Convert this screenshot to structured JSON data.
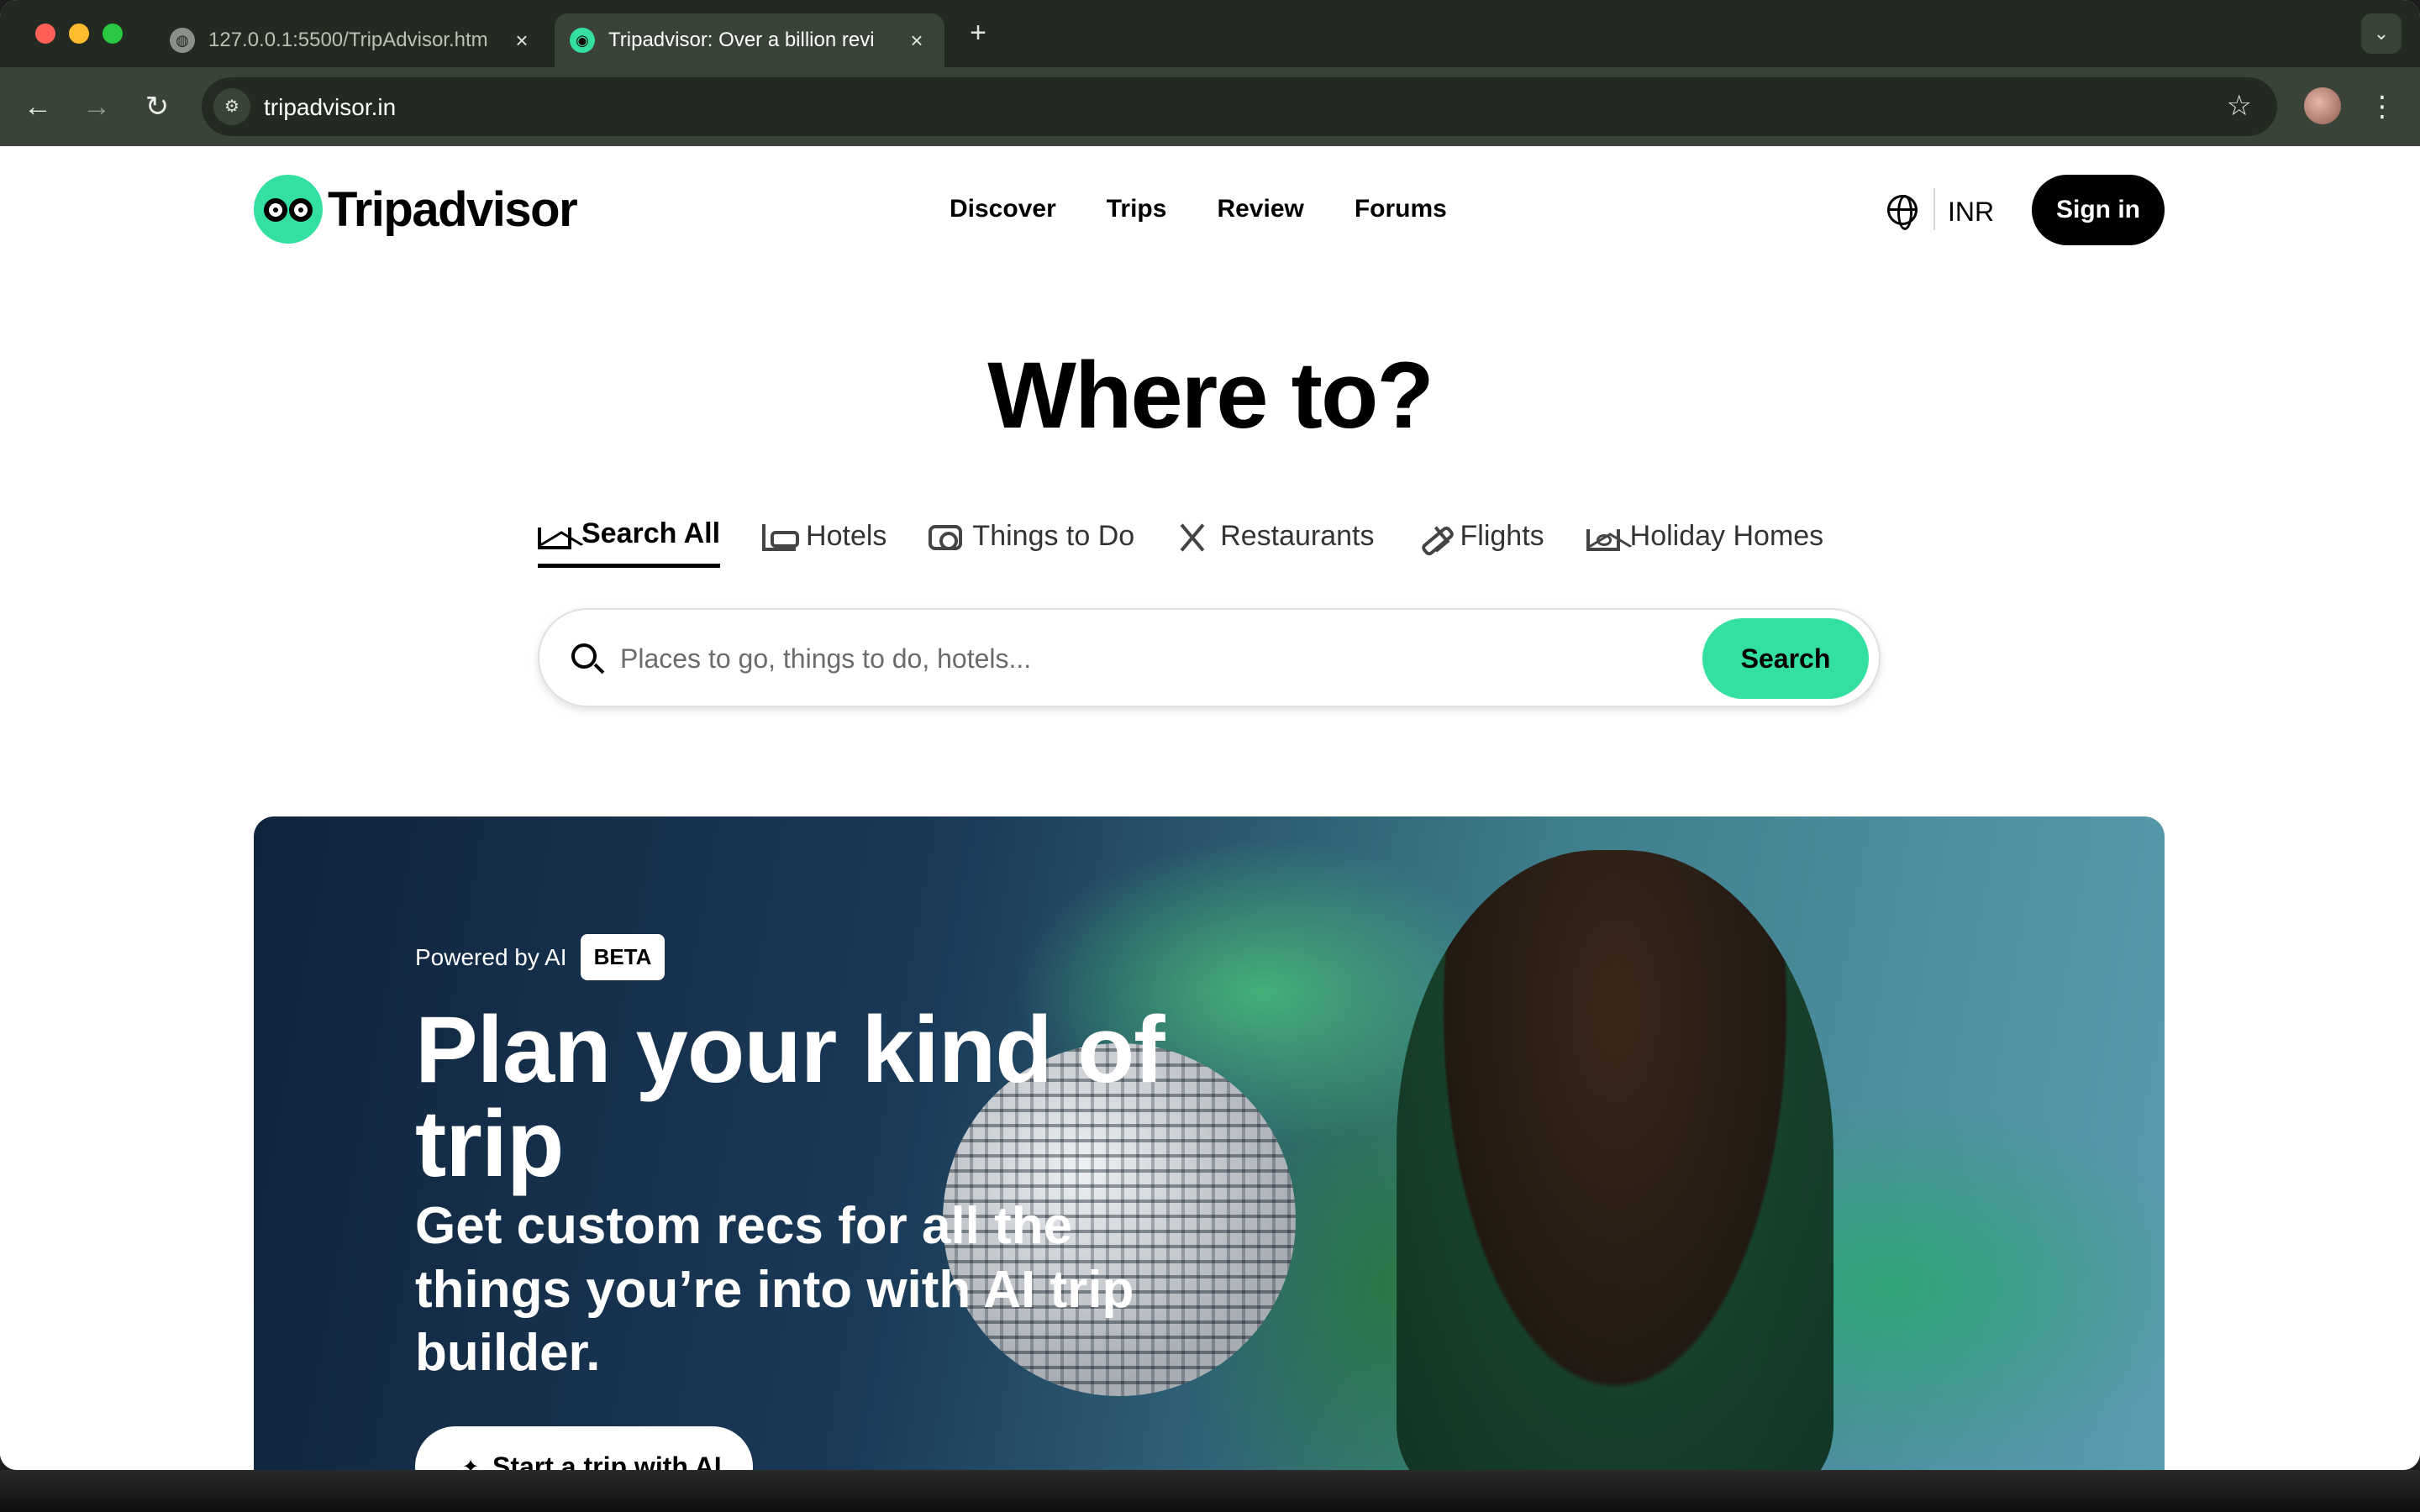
{
  "browser": {
    "tabs": [
      {
        "title": "127.0.0.1:5500/TripAdvisor.htm",
        "favicon": "globe-icon"
      },
      {
        "title": "Tripadvisor: Over a billion revi",
        "favicon": "tripadvisor-owl-icon",
        "active": true
      }
    ],
    "new_tab": "+",
    "address": "tripadvisor.in"
  },
  "header": {
    "logo_text": "Tripadvisor",
    "nav": [
      "Discover",
      "Trips",
      "Review",
      "Forums"
    ],
    "currency": "INR",
    "sign_in": "Sign in"
  },
  "hero": {
    "title": "Where to?",
    "categories": [
      {
        "label": "Search All",
        "icon": "home-icon",
        "active": true
      },
      {
        "label": "Hotels",
        "icon": "bed-icon"
      },
      {
        "label": "Things to Do",
        "icon": "camera-icon"
      },
      {
        "label": "Restaurants",
        "icon": "fork-knife-icon"
      },
      {
        "label": "Flights",
        "icon": "plane-icon"
      },
      {
        "label": "Holiday Homes",
        "icon": "house-key-icon"
      }
    ],
    "search": {
      "placeholder": "Places to go, things to do, hotels...",
      "button": "Search"
    }
  },
  "promo": {
    "powered_by": "Powered by AI",
    "badge": "BETA",
    "title": "Plan your kind of trip",
    "subtitle": "Get custom recs for all the things you’re into with AI trip builder.",
    "cta": "Start a trip with AI"
  },
  "colors": {
    "brand_green": "#34e0a1",
    "chrome_dark": "#232a21",
    "chrome_toolbar": "#3a4337"
  }
}
